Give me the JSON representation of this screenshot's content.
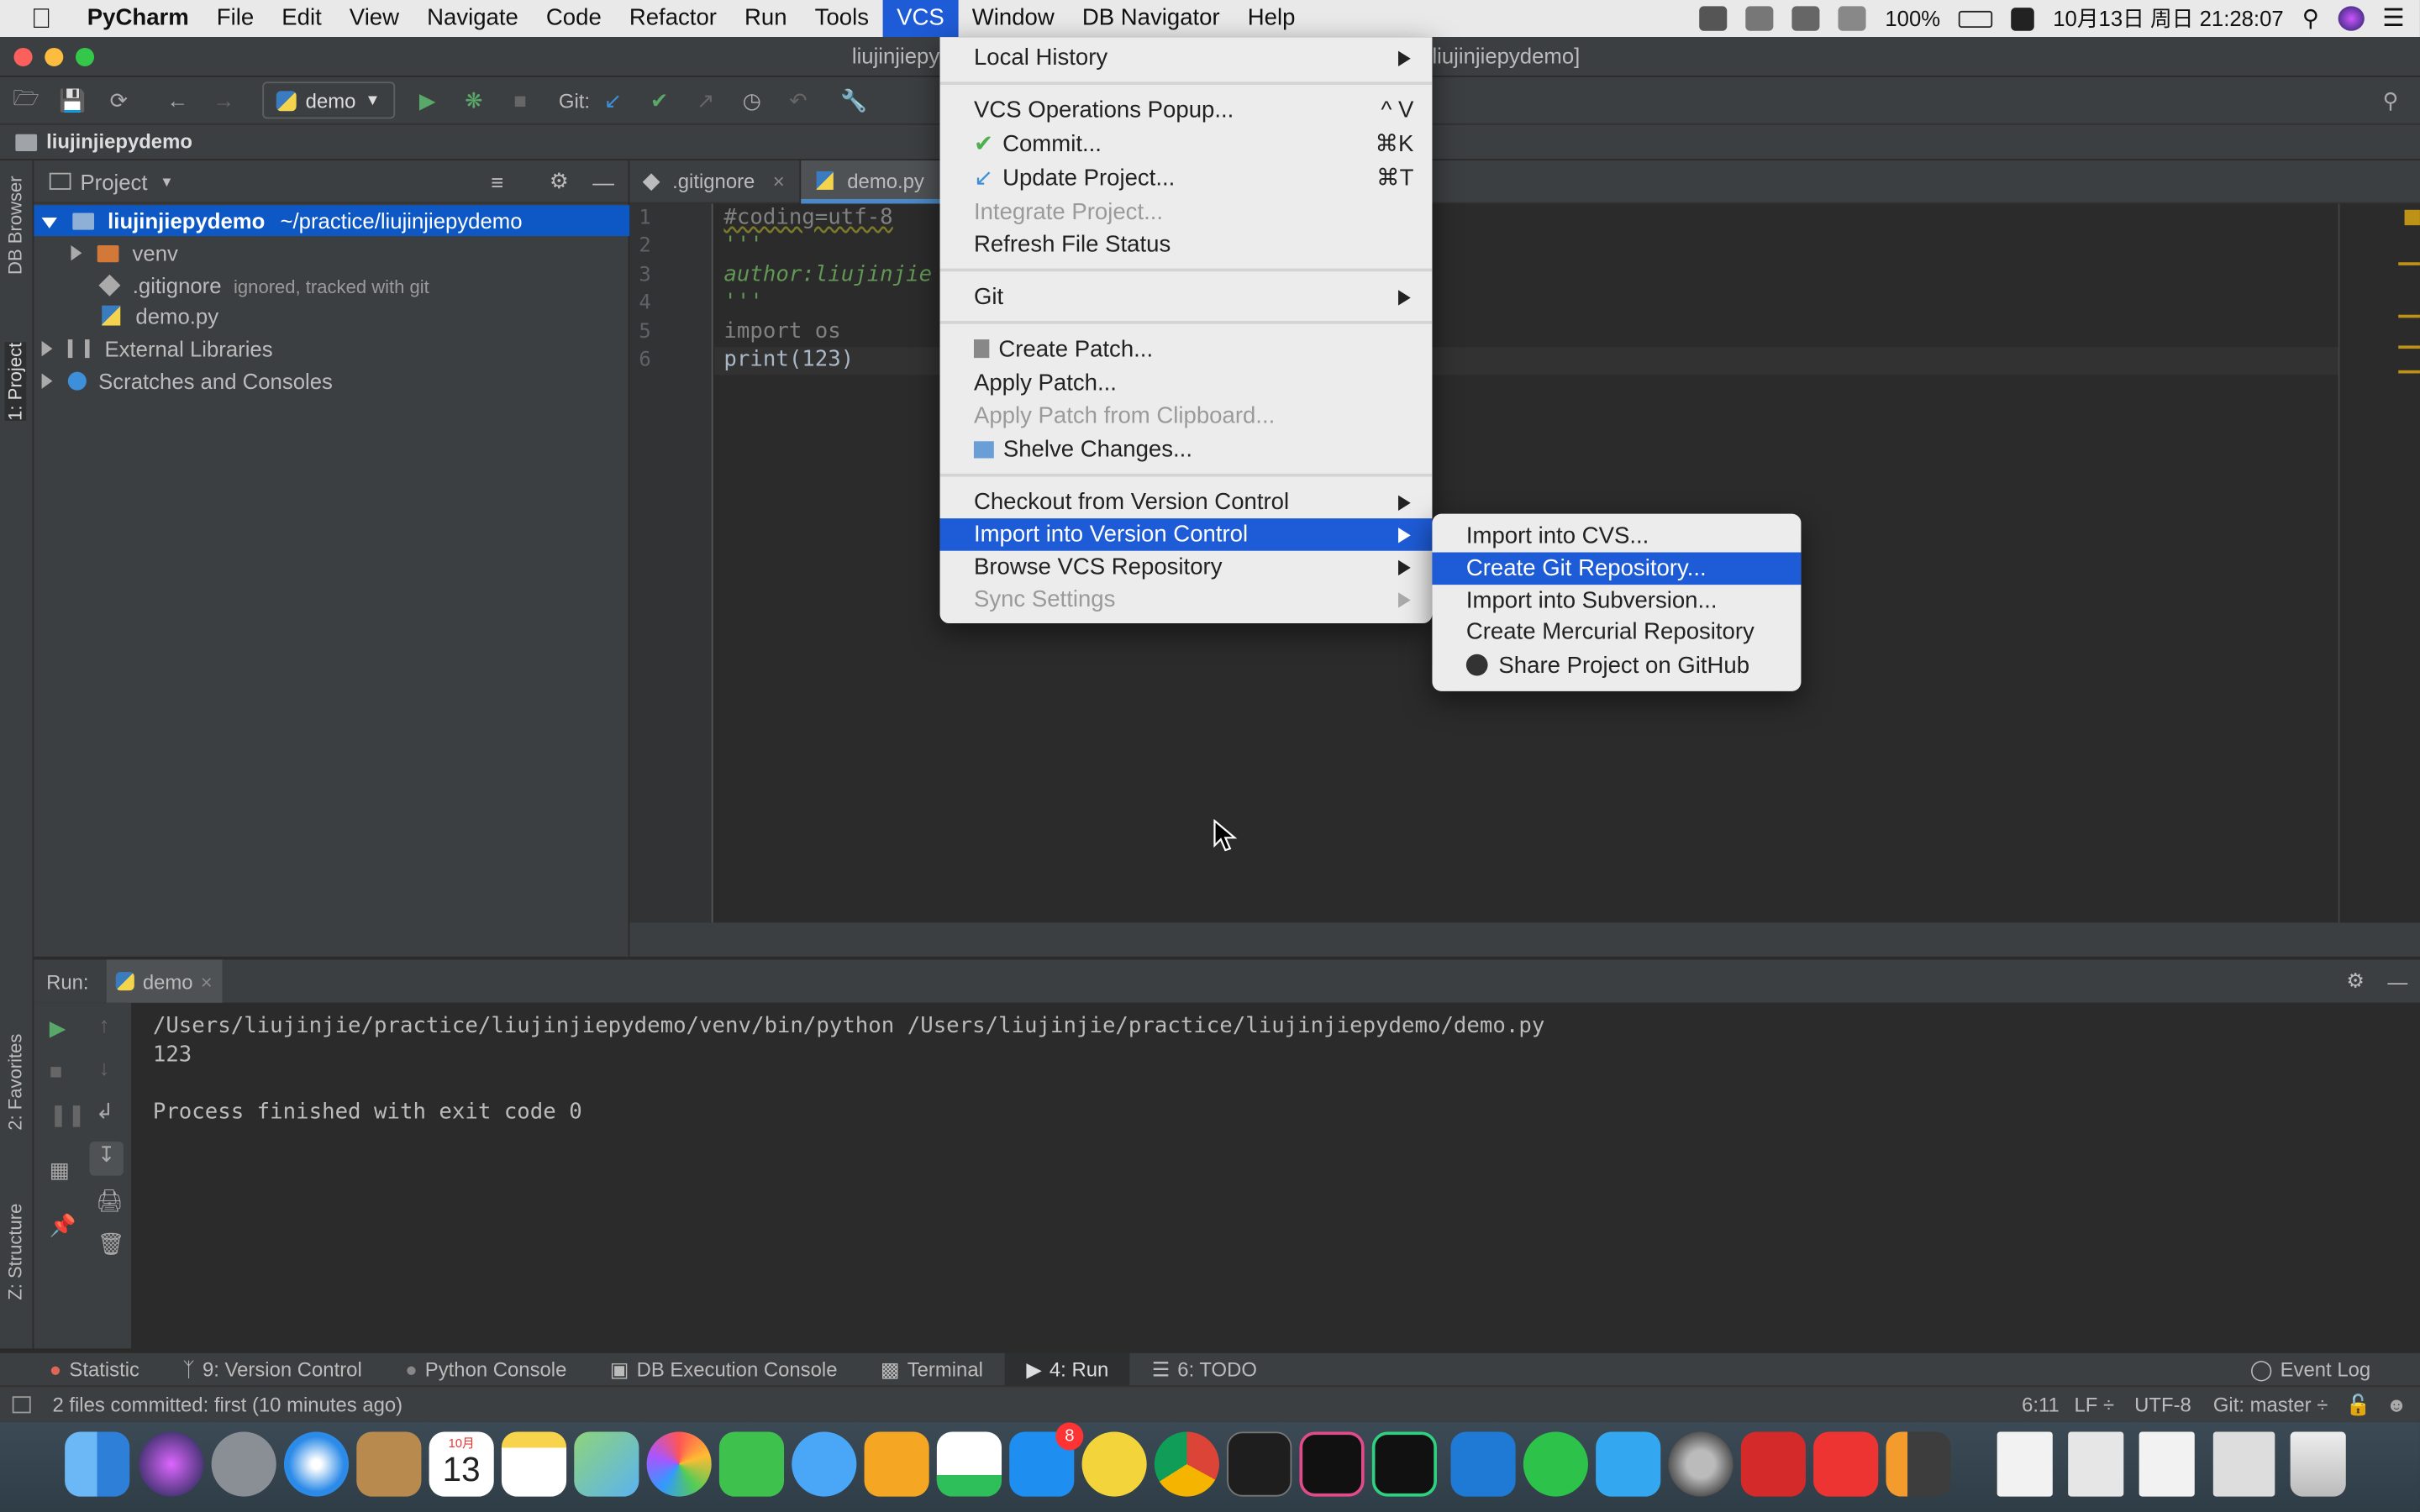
{
  "menubar": {
    "app": "PyCharm",
    "items": [
      "File",
      "Edit",
      "View",
      "Navigate",
      "Code",
      "Refactor",
      "Run",
      "Tools",
      "VCS",
      "Window",
      "DB Navigator",
      "Help"
    ],
    "active": "VCS",
    "battery": "100%",
    "datetime": "10月13日 周日  21:28:07"
  },
  "window": {
    "title_left": "liujinjiepy",
    "title_right": "liujinjiepydemo]"
  },
  "toolbar": {
    "run_config": "demo",
    "git_label": "Git:"
  },
  "navbar": {
    "crumb": "liujinjiepydemo"
  },
  "side_tabs": {
    "db_browser": "DB Browser",
    "project": "1: Project",
    "favorites": "2: Favorites",
    "structure": "Z: Structure"
  },
  "project": {
    "header": "Project",
    "tree": [
      {
        "label": "liujinjiepydemo",
        "extra": "~/practice/liujinjiepydemo"
      },
      {
        "label": "venv",
        "extra": ""
      },
      {
        "label": ".gitignore",
        "extra": "ignored, tracked with git"
      },
      {
        "label": "demo.py",
        "extra": ""
      },
      {
        "label": "External Libraries",
        "extra": ""
      },
      {
        "label": "Scratches and Consoles",
        "extra": ""
      }
    ]
  },
  "editor": {
    "tabs": [
      ".gitignore",
      "demo.py"
    ],
    "lines": [
      "1",
      "2",
      "3",
      "4",
      "5",
      "6"
    ],
    "code": [
      "#coding=utf-8",
      "'''",
      "author:liujinjie",
      "'''",
      "import os",
      "print(123)"
    ]
  },
  "run": {
    "label": "Run:",
    "tab": "demo",
    "output": [
      "/Users/liujinjie/practice/liujinjiepydemo/venv/bin/python /Users/liujinjie/practice/liujinjiepydemo/demo.py",
      "123",
      "",
      "Process finished with exit code 0"
    ]
  },
  "bottom_tabs": [
    "Statistic",
    "9: Version Control",
    "Python Console",
    "DB Execution Console",
    "Terminal",
    "4: Run",
    "6: TODO"
  ],
  "event_log": "Event Log",
  "status": {
    "message": "2 files committed: first (10 minutes ago)",
    "position": "6:11",
    "line_sep": "LF ÷",
    "encoding": "UTF-8",
    "branch": "Git: master ÷"
  },
  "vcs_menu": {
    "items": [
      {
        "label": "Local History",
        "shortcut": "",
        "submenu": true,
        "disabled": false
      },
      {
        "label": "VCS Operations Popup...",
        "shortcut": "^ V",
        "submenu": false,
        "disabled": false
      },
      {
        "label": "Commit...",
        "shortcut": "⌘K",
        "submenu": false,
        "disabled": false
      },
      {
        "label": "Update Project...",
        "shortcut": "⌘T",
        "submenu": false,
        "disabled": false
      },
      {
        "label": "Integrate Project...",
        "shortcut": "",
        "submenu": false,
        "disabled": true
      },
      {
        "label": "Refresh File Status",
        "shortcut": "",
        "submenu": false,
        "disabled": false
      },
      {
        "label": "Git",
        "shortcut": "",
        "submenu": true,
        "disabled": false
      },
      {
        "label": "Create Patch...",
        "shortcut": "",
        "submenu": false,
        "disabled": false
      },
      {
        "label": "Apply Patch...",
        "shortcut": "",
        "submenu": false,
        "disabled": false
      },
      {
        "label": "Apply Patch from Clipboard...",
        "shortcut": "",
        "submenu": false,
        "disabled": true
      },
      {
        "label": "Shelve Changes...",
        "shortcut": "",
        "submenu": false,
        "disabled": false
      },
      {
        "label": "Checkout from Version Control",
        "shortcut": "",
        "submenu": true,
        "disabled": false
      },
      {
        "label": "Import into Version Control",
        "shortcut": "",
        "submenu": true,
        "disabled": false
      },
      {
        "label": "Browse VCS Repository",
        "shortcut": "",
        "submenu": true,
        "disabled": false
      },
      {
        "label": "Sync Settings",
        "shortcut": "",
        "submenu": true,
        "disabled": true
      }
    ]
  },
  "import_submenu": {
    "items": [
      "Import into CVS...",
      "Create Git Repository...",
      "Import into Subversion...",
      "Create Mercurial Repository",
      "Share Project on GitHub"
    ]
  },
  "dock": {
    "calendar_month": "10月",
    "calendar_day": "13",
    "appstore_badge": "8"
  }
}
